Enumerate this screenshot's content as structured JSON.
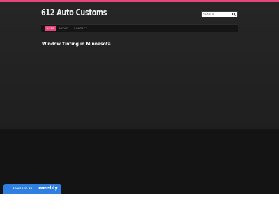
{
  "site": {
    "title": "612 Auto Customs"
  },
  "search": {
    "placeholder": "SEARCH"
  },
  "nav": {
    "items": [
      {
        "label": "HOME",
        "active": true
      },
      {
        "label": "ABOUT",
        "active": false
      },
      {
        "label": "CONTACT",
        "active": false
      }
    ]
  },
  "content": {
    "heading": "Window Tinting in Minnesota"
  },
  "badge": {
    "powered_by": "POWERED BY",
    "brand": "weebly"
  },
  "colors": {
    "accent": "#e8457a",
    "badge_blue": "#2f7fe0",
    "nav_background": "#151515"
  },
  "icons": {
    "search": "magnifier-icon"
  }
}
